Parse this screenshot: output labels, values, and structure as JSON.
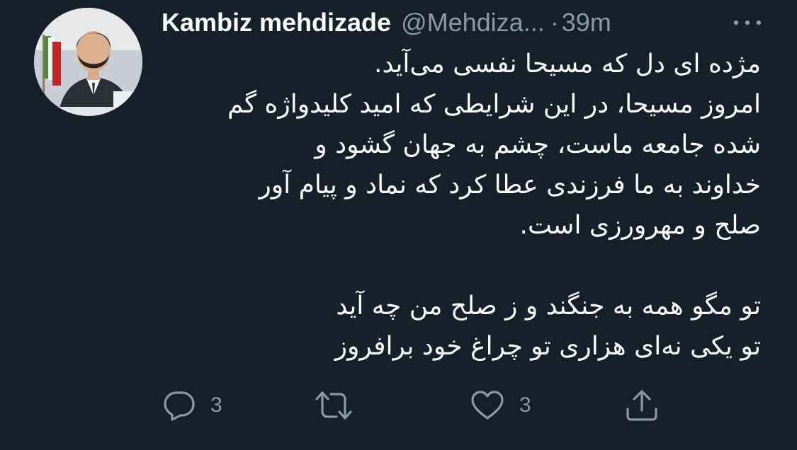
{
  "tweet": {
    "author_name": "Kambiz mehdizade",
    "handle": "@Mehdiza...",
    "separator": "·",
    "time": "39m",
    "text_lines": [
      "مژده ای دل که مسیحا نفسی می‌آید.",
      "امروز مسیحا، در این شرایطی که امید کلیدواژه گم",
      "شده جامعه ماست، چشم به جهان گشود و",
      "خداوند به ما فرزندی عطا کرد که نماد و پیام آور",
      "صلح و مهرورزی است.",
      "",
      "تو مگو همه به جنگند و ز صلح من چه آید",
      "تو یکی نه‌ای هزاری تو چراغ خود برافروز"
    ]
  },
  "actions": {
    "reply_count": "3",
    "like_count": "3"
  },
  "icons": {
    "avatar": "profile-photo",
    "more": "more-dots-icon",
    "reply": "reply-icon",
    "retweet": "retweet-icon",
    "like": "heart-icon",
    "share": "share-icon"
  },
  "colors": {
    "background": "#15202b",
    "text": "#ffffff",
    "secondary": "#8b98a5"
  }
}
